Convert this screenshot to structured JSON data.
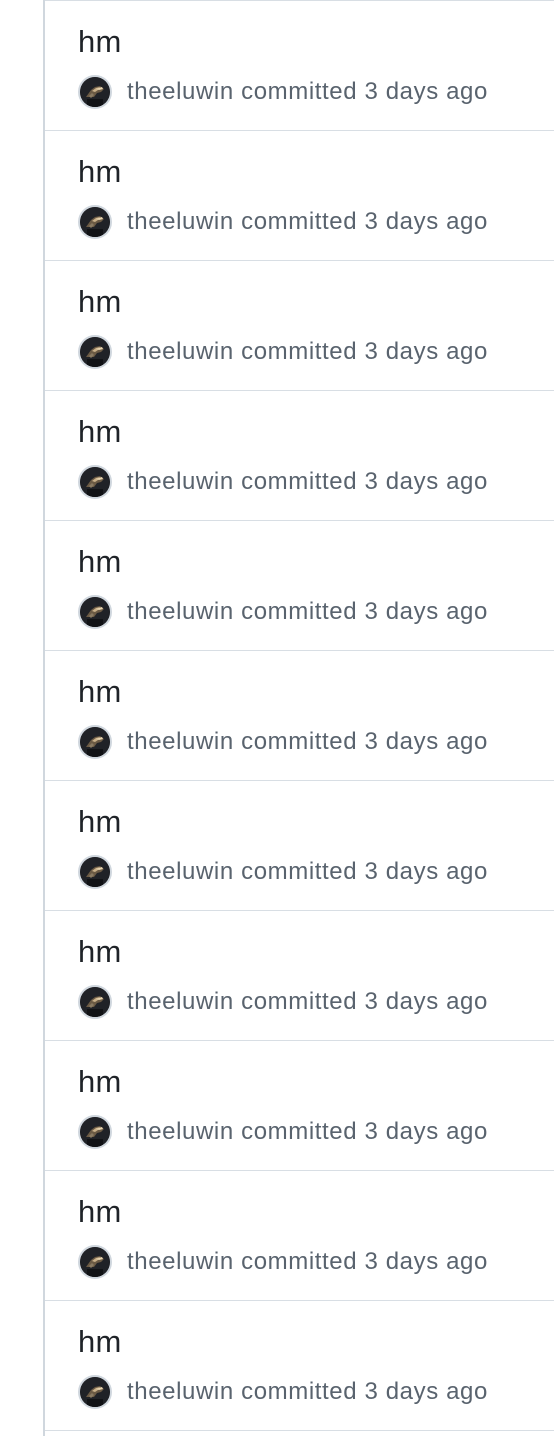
{
  "commits": [
    {
      "title": "hm",
      "author": "theeluwin",
      "action": "committed",
      "time": "3 days ago"
    },
    {
      "title": "hm",
      "author": "theeluwin",
      "action": "committed",
      "time": "3 days ago"
    },
    {
      "title": "hm",
      "author": "theeluwin",
      "action": "committed",
      "time": "3 days ago"
    },
    {
      "title": "hm",
      "author": "theeluwin",
      "action": "committed",
      "time": "3 days ago"
    },
    {
      "title": "hm",
      "author": "theeluwin",
      "action": "committed",
      "time": "3 days ago"
    },
    {
      "title": "hm",
      "author": "theeluwin",
      "action": "committed",
      "time": "3 days ago"
    },
    {
      "title": "hm",
      "author": "theeluwin",
      "action": "committed",
      "time": "3 days ago"
    },
    {
      "title": "hm",
      "author": "theeluwin",
      "action": "committed",
      "time": "3 days ago"
    },
    {
      "title": "hm",
      "author": "theeluwin",
      "action": "committed",
      "time": "3 days ago"
    },
    {
      "title": "hm",
      "author": "theeluwin",
      "action": "committed",
      "time": "3 days ago"
    },
    {
      "title": "hm",
      "author": "theeluwin",
      "action": "committed",
      "time": "3 days ago"
    }
  ],
  "colors": {
    "title": "#1f2328",
    "meta": "#59636e",
    "border": "#d8dee4"
  },
  "icons": {
    "avatar": "user-avatar-icon"
  }
}
